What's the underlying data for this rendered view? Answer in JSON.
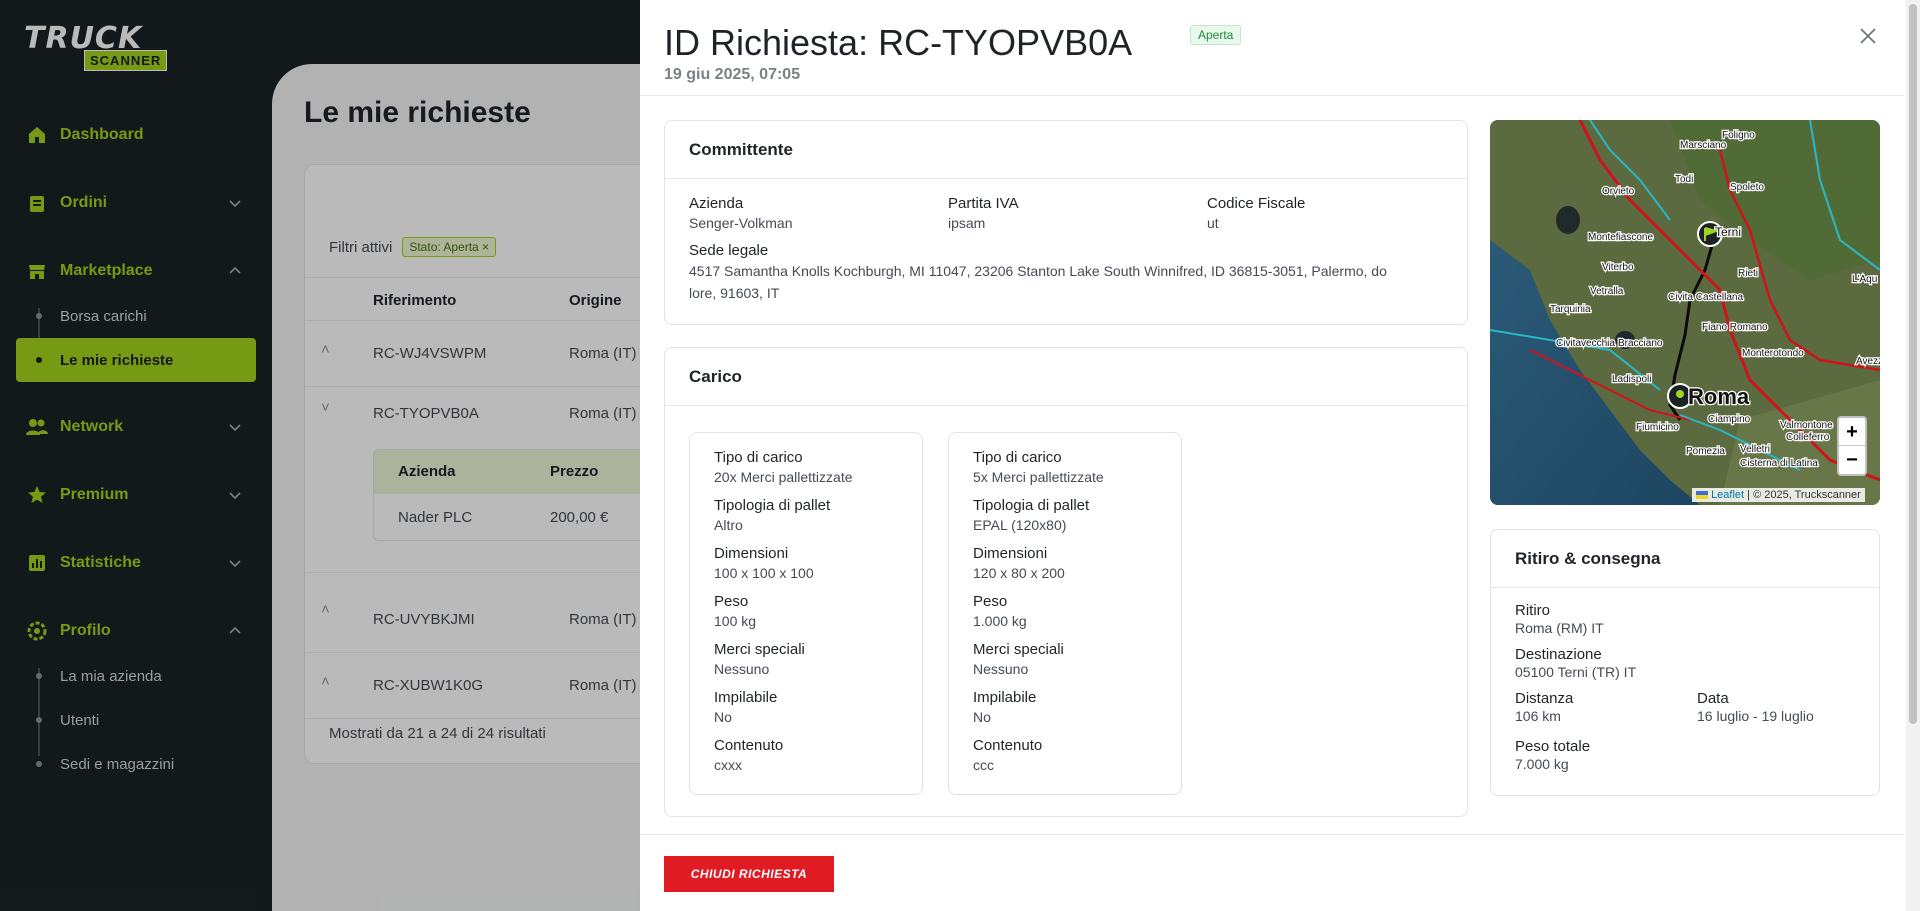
{
  "brand": {
    "logo_line1": "TRUCK",
    "logo_line2": "SCANNER"
  },
  "sidebar": {
    "items": [
      {
        "label": "Dashboard"
      },
      {
        "label": "Ordini"
      },
      {
        "label": "Marketplace",
        "sub": [
          "Borsa carichi",
          "Le mie richieste"
        ]
      },
      {
        "label": "Network"
      },
      {
        "label": "Premium"
      },
      {
        "label": "Statistiche"
      },
      {
        "label": "Profilo",
        "sub": [
          "La mia azienda",
          "Utenti",
          "Sedi e magazzini"
        ]
      }
    ]
  },
  "page": {
    "title": "Le mie richieste",
    "filters_label": "Filtri attivi",
    "filter_chip": "Stato: Aperta ×",
    "columns": [
      "Riferimento",
      "Origine"
    ],
    "rows": [
      {
        "ref": "RC-WJ4VSWPM",
        "origin": "Roma (IT)"
      },
      {
        "ref": "RC-TYOPVB0A",
        "origin": "Roma (IT)"
      },
      {
        "ref": "RC-UVYBKJMI",
        "origin": "Roma (IT)"
      },
      {
        "ref": "RC-XUBW1K0G",
        "origin": "Roma (IT)"
      }
    ],
    "subtable": {
      "col1": "Azienda",
      "col2": "Prezzo",
      "company": "Nader PLC",
      "price": "200,00 €"
    },
    "footer": "Mostrati da 21 a 24 di 24 risultati"
  },
  "drawer": {
    "title": "ID Richiesta: RC-TYOPVB0A",
    "status": "Aperta",
    "date": "19 giu 2025, 07:05",
    "committente": {
      "heading": "Committente",
      "azienda_label": "Azienda",
      "azienda": "Senger-Volkman",
      "piva_label": "Partita IVA",
      "piva": "ipsam",
      "cf_label": "Codice Fiscale",
      "cf": "ut",
      "sede_label": "Sede legale",
      "sede_line1": "4517 Samantha Knolls Kochburgh, MI 11047, 23206 Stanton Lake South Winnifred, ID 36815-3051, Palermo, do",
      "sede_line2": "lore, 91603, IT"
    },
    "carico": {
      "heading": "Carico",
      "items": [
        {
          "tipo": "20x Merci pallettizzate",
          "pallet": "Altro",
          "dim": "100 x 100 x 100",
          "peso": "100 kg",
          "speciali": "Nessuno",
          "impilabile": "No",
          "contenuto": "cxxx"
        },
        {
          "tipo": "5x Merci pallettizzate",
          "pallet": "EPAL (120x80)",
          "dim": "120 x 80 x 200",
          "peso": "1.000 kg",
          "speciali": "Nessuno",
          "impilabile": "No",
          "contenuto": "ccc"
        }
      ],
      "labels": {
        "tipo": "Tipo di carico",
        "pallet": "Tipologia di pallet",
        "dim": "Dimensioni",
        "peso": "Peso",
        "speciali": "Merci speciali",
        "impilabile": "Impilabile",
        "contenuto": "Contenuto"
      }
    },
    "map": {
      "zoom_in": "+",
      "zoom_out": "−",
      "attribution_link": "Leaflet",
      "attribution_text": " | © 2025, Truckscanner",
      "city_labels": [
        "Foligno",
        "Marsciano",
        "Todi",
        "Spoleto",
        "Orvieto",
        "Montefiascone",
        "Terni",
        "Viterbo",
        "Rieti",
        "Vetralla",
        "Civita Castellana",
        "L'Aqu",
        "Tarquinia",
        "Fiano Romano",
        "Civitavecchia",
        "Bracciano",
        "Monterotondo",
        "Ladispoli",
        "Roma",
        "Fiumicino",
        "Ciampino",
        "Valmontone",
        "Colleferro",
        "Pomezia",
        "Velletri",
        "Cisterna di Latina",
        "Avezz"
      ]
    },
    "ritiro": {
      "heading": "Ritiro & consegna",
      "ritiro_label": "Ritiro",
      "ritiro": "Roma (RM) IT",
      "dest_label": "Destinazione",
      "dest": "05100 Terni (TR) IT",
      "dist_label": "Distanza",
      "dist": "106 km",
      "data_label": "Data",
      "data": "16 luglio - 19 luglio",
      "peso_label": "Peso totale",
      "peso": "7.000 kg"
    },
    "close_button": "CHIUDI RICHIESTA"
  },
  "colors": {
    "accent": "#a4d31d",
    "sidebar": "#1b2326",
    "danger": "#e01b24",
    "status": "#1d8a3a"
  }
}
